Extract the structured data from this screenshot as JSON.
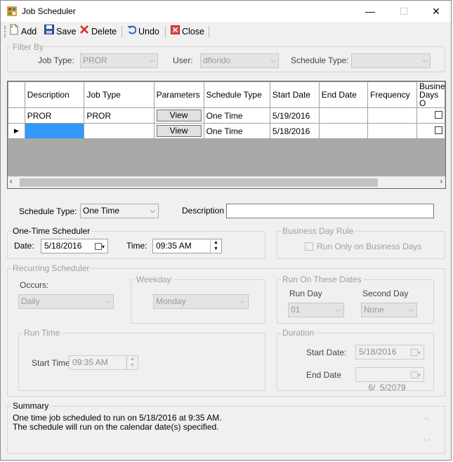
{
  "window": {
    "title": "Job Scheduler",
    "minimize": "—",
    "maximize": "☐",
    "close": "✕"
  },
  "toolbar": {
    "add": "Add",
    "save": "Save",
    "delete": "Delete",
    "undo": "Undo",
    "close": "Close"
  },
  "filter": {
    "group_label": "Filter By",
    "job_type_label": "Job Type:",
    "job_type_value": "PROR",
    "user_label": "User:",
    "user_value": "dflorido",
    "schedule_type_label": "Schedule Type:",
    "schedule_type_value": ""
  },
  "grid": {
    "headers": [
      "Description",
      "Job Type",
      "Parameters",
      "Schedule Type",
      "Start Date",
      "End Date",
      "Frequency",
      "Business Days O"
    ],
    "rows": [
      {
        "description": "PROR",
        "job_type": "PROR",
        "parameters": "View",
        "schedule_type": "One Time",
        "start_date": "5/19/2016",
        "end_date": "",
        "frequency": ""
      },
      {
        "description": "",
        "job_type": "",
        "parameters": "View",
        "schedule_type": "One Time",
        "start_date": "5/18/2016",
        "end_date": "",
        "frequency": ""
      }
    ],
    "current_row_marker": "▶"
  },
  "details": {
    "schedule_type_label": "Schedule Type:",
    "schedule_type_value": "One Time",
    "description_label": "Description",
    "description_value": ""
  },
  "one_time": {
    "group_label": "One-Time Scheduler",
    "date_label": "Date:",
    "date_value": "5/18/2016",
    "time_label": "Time:",
    "time_value": "09:35 AM"
  },
  "business_day_rule": {
    "group_label": "Business Day Rule",
    "checkbox_label": "Run Only on Business Days"
  },
  "recurring": {
    "group_label": "Recurring Scheduler",
    "occurs_label": "Occurs:",
    "occurs_value": "Daily",
    "weekday_label": "Weekday",
    "weekday_value": "Monday",
    "run_dates_label": "Run On These Dates",
    "run_day_label": "Run Day",
    "run_day_value": "01",
    "second_day_label": "Second Day",
    "second_day_value": "None",
    "run_time_label": "Run Time",
    "start_time_label": "Start Time",
    "start_time_value": "09:35 AM",
    "duration_label": "Duration",
    "start_date_label": "Start Date:",
    "start_date_value": "5/18/2016",
    "end_date_label": "End Date",
    "end_date_value": "6/  5/2079"
  },
  "summary": {
    "label": "Summary",
    "line1": "One time job scheduled to run on 5/18/2016 at 9:35 AM.",
    "line2": "The schedule will run on the calendar date(s) specified."
  }
}
